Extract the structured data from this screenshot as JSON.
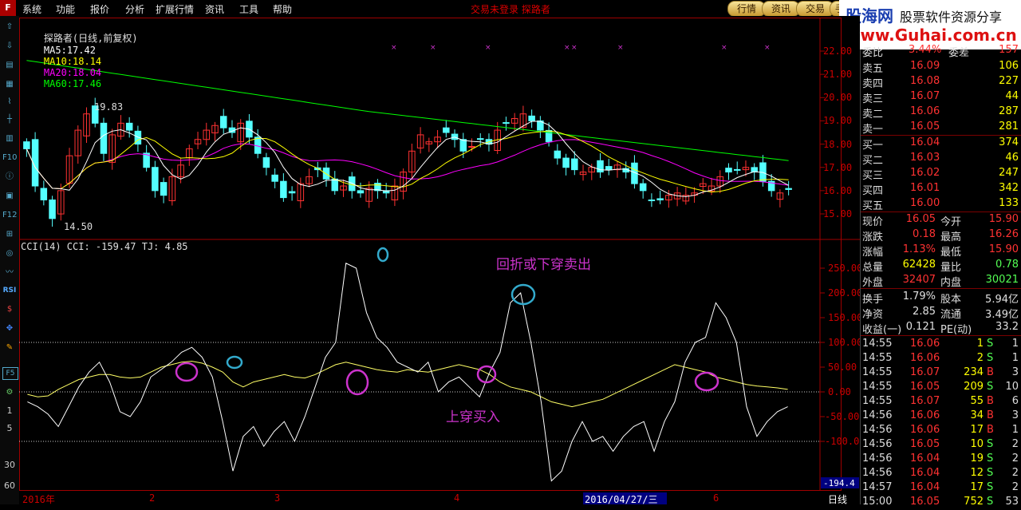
{
  "menu": {
    "logo": "F",
    "items": [
      "系统",
      "功能",
      "报价",
      "分析",
      "扩展行情",
      "资讯",
      "工具",
      "帮助"
    ],
    "title": "交易未登录   探路者",
    "tabs": [
      "行情",
      "资讯",
      "交易",
      "手"
    ]
  },
  "ad": {
    "site": "股海网",
    "slogan": "股票软件资源分享",
    "url": "www.Guhai.com.cn"
  },
  "toolbar": {
    "icons": [
      "up-arrow-icon",
      "down-arrow-icon",
      "left-arrow-icon",
      "right-arrow-icon",
      "report-icon",
      "grid-icon",
      "line-chart-icon",
      "kline-icon",
      "candles-icon",
      "f10-icon",
      "info-icon",
      "table-icon",
      "f12-icon",
      "quote-icon",
      "circle-icon",
      "rsi-icon",
      "dollar-icon",
      "cross-icon",
      "pencil-icon",
      "f5-icon",
      "settings-icon"
    ],
    "rsi_label": "RSI",
    "f5_label": "F5",
    "f10_label": "F10",
    "f12_label": "F12",
    "periods": [
      "1",
      "5",
      "30",
      "60"
    ]
  },
  "price_legend": {
    "name": "探路者(日线,前复权)",
    "ma5_label": "MA5:",
    "ma5": "17.42",
    "ma10_label": "MA10:",
    "ma10": "18.14",
    "ma20_label": "MA20:",
    "ma20": "18.04",
    "ma60_label": "MA60:",
    "ma60": "17.46",
    "high_mark": "19.83",
    "low_mark": "14.50"
  },
  "cci_legend": {
    "text": "CCI(14) CCI: -159.47 TJ: 4.85"
  },
  "annotations": {
    "sell": "回折或下穿卖出",
    "buy": "上穿买入"
  },
  "price_axis": [
    "22.00",
    "21.00",
    "20.00",
    "19.00",
    "18.00",
    "17.00",
    "16.00",
    "15.00"
  ],
  "cci_axis": [
    "250.00",
    "200.00",
    "150.00",
    "100.00",
    "50.00",
    "0.00",
    "-50.00",
    "-100.00"
  ],
  "cci_cursor_value": "-194.4",
  "date_axis": {
    "labels": [
      "2016年",
      "2",
      "3",
      "4",
      "6"
    ],
    "highlight": "2016/04/27/三",
    "period": "日线"
  },
  "colors": {
    "up": "#ff3232",
    "down": "#54ffff",
    "ma5": "#ffffff",
    "ma10": "#ffff00",
    "ma20": "#ff00ff",
    "ma60": "#00ff00",
    "annotation": "#cc33cc",
    "circle_teal": "#33aacc"
  },
  "order_book": {
    "header": [
      "委比",
      "3.44%",
      "委差",
      "157"
    ],
    "asks": [
      {
        "label": "卖五",
        "price": "16.09",
        "vol": "106"
      },
      {
        "label": "卖四",
        "price": "16.08",
        "vol": "227"
      },
      {
        "label": "卖三",
        "price": "16.07",
        "vol": "44"
      },
      {
        "label": "卖二",
        "price": "16.06",
        "vol": "287"
      },
      {
        "label": "卖一",
        "price": "16.05",
        "vol": "281"
      }
    ],
    "bids": [
      {
        "label": "买一",
        "price": "16.04",
        "vol": "374"
      },
      {
        "label": "买二",
        "price": "16.03",
        "vol": "46"
      },
      {
        "label": "买三",
        "price": "16.02",
        "vol": "247"
      },
      {
        "label": "买四",
        "price": "16.01",
        "vol": "342"
      },
      {
        "label": "买五",
        "price": "16.00",
        "vol": "133"
      }
    ]
  },
  "stats": [
    {
      "k1": "现价",
      "v1": "16.05",
      "k2": "今开",
      "v2": "15.90",
      "c1": "#ff3232",
      "c2": "#ff3232"
    },
    {
      "k1": "涨跌",
      "v1": "0.18",
      "k2": "最高",
      "v2": "16.26",
      "c1": "#ff3232",
      "c2": "#ff3232"
    },
    {
      "k1": "涨幅",
      "v1": "1.13%",
      "k2": "最低",
      "v2": "15.90",
      "c1": "#ff3232",
      "c2": "#ff3232"
    },
    {
      "k1": "总量",
      "v1": "62428",
      "k2": "量比",
      "v2": "0.78",
      "c1": "#ffff00",
      "c2": "#54ff54"
    },
    {
      "k1": "外盘",
      "v1": "32407",
      "k2": "内盘",
      "v2": "30021",
      "c1": "#ff3232",
      "c2": "#54ff54"
    },
    {
      "k1": "换手",
      "v1": "1.79%",
      "k2": "股本",
      "v2": "5.94亿",
      "c1": "#e0e0e0",
      "c2": "#e0e0e0"
    },
    {
      "k1": "净资",
      "v1": "2.85",
      "k2": "流通",
      "v2": "3.49亿",
      "c1": "#e0e0e0",
      "c2": "#e0e0e0"
    },
    {
      "k1": "收益(一)",
      "v1": "0.121",
      "k2": "PE(动)",
      "v2": "33.2",
      "c1": "#e0e0e0",
      "c2": "#e0e0e0"
    }
  ],
  "ticks": [
    {
      "time": "14:55",
      "price": "16.06",
      "vol": "1",
      "side": "S",
      "n": "1"
    },
    {
      "time": "14:55",
      "price": "16.06",
      "vol": "2",
      "side": "S",
      "n": "1"
    },
    {
      "time": "14:55",
      "price": "16.07",
      "vol": "234",
      "side": "B",
      "n": "3"
    },
    {
      "time": "14:55",
      "price": "16.05",
      "vol": "209",
      "side": "S",
      "n": "10"
    },
    {
      "time": "14:55",
      "price": "16.07",
      "vol": "55",
      "side": "B",
      "n": "6"
    },
    {
      "time": "14:56",
      "price": "16.06",
      "vol": "34",
      "side": "B",
      "n": "3"
    },
    {
      "time": "14:56",
      "price": "16.06",
      "vol": "17",
      "side": "B",
      "n": "1"
    },
    {
      "time": "14:56",
      "price": "16.05",
      "vol": "10",
      "side": "S",
      "n": "2"
    },
    {
      "time": "14:56",
      "price": "16.04",
      "vol": "19",
      "side": "S",
      "n": "2"
    },
    {
      "time": "14:56",
      "price": "16.04",
      "vol": "12",
      "side": "S",
      "n": "2"
    },
    {
      "time": "14:57",
      "price": "16.04",
      "vol": "17",
      "side": "S",
      "n": "2"
    },
    {
      "time": "15:00",
      "price": "16.05",
      "vol": "752",
      "side": "S",
      "n": "53"
    }
  ],
  "chart_data": {
    "type": "line",
    "candles_close": [
      17.8,
      16.2,
      15.6,
      14.8,
      16.0,
      17.5,
      18.6,
      19.3,
      18.9,
      17.6,
      18.4,
      18.9,
      18.6,
      18.0,
      17.0,
      16.0,
      15.8,
      16.6,
      17.1,
      17.8,
      18.2,
      18.6,
      18.8,
      18.7,
      18.5,
      18.9,
      18.3,
      17.6,
      17.0,
      16.4,
      15.7,
      15.9,
      16.3,
      16.6,
      16.9,
      16.5,
      16.0,
      16.2,
      16.0,
      15.9,
      16.1,
      16.0,
      15.9,
      16.2,
      16.8,
      17.7,
      18.4,
      18.1,
      18.3,
      18.5,
      18.2,
      17.7,
      17.9,
      18.2,
      18.0,
      18.6,
      18.9,
      19.1,
      19.3,
      19.0,
      18.6,
      18.1,
      17.4,
      17.0,
      16.9,
      16.8,
      17.0,
      16.8,
      16.9,
      17.1,
      16.8,
      16.3,
      16.0,
      15.6,
      15.6,
      15.8,
      15.9,
      15.8,
      15.9,
      16.3,
      16.2,
      16.6,
      16.8,
      16.9,
      17.0,
      16.8,
      16.4,
      16.0,
      15.9,
      16.05
    ],
    "cci": [
      -20,
      -30,
      -45,
      -70,
      -30,
      10,
      40,
      60,
      20,
      -40,
      -50,
      -20,
      30,
      45,
      60,
      80,
      90,
      70,
      30,
      -60,
      -160,
      -90,
      -70,
      -110,
      -80,
      -60,
      -100,
      -50,
      10,
      70,
      100,
      260,
      250,
      160,
      110,
      90,
      60,
      50,
      40,
      60,
      0,
      20,
      30,
      10,
      -10,
      40,
      80,
      180,
      200,
      100,
      -20,
      -180,
      -160,
      -100,
      -60,
      -100,
      -90,
      -120,
      -90,
      -70,
      -60,
      -120,
      -60,
      -20,
      60,
      100,
      110,
      180,
      150,
      100,
      -30,
      -90,
      -60,
      -40,
      -30
    ],
    "tj": [
      -5,
      -10,
      -8,
      5,
      15,
      25,
      30,
      35,
      35,
      30,
      28,
      30,
      40,
      50,
      55,
      60,
      62,
      58,
      50,
      40,
      20,
      10,
      20,
      25,
      30,
      35,
      30,
      28,
      35,
      45,
      55,
      60,
      55,
      50,
      45,
      42,
      40,
      45,
      42,
      40,
      45,
      50,
      55,
      50,
      45,
      35,
      20,
      10,
      5,
      0,
      -10,
      -20,
      -25,
      -30,
      -25,
      -20,
      -15,
      -5,
      5,
      15,
      25,
      35,
      45,
      55,
      50,
      45,
      40,
      30,
      25,
      20,
      15,
      12,
      10,
      8,
      5
    ],
    "series": [
      {
        "name": "MA5",
        "values": []
      },
      {
        "name": "MA10",
        "values": []
      },
      {
        "name": "MA20",
        "values": []
      },
      {
        "name": "MA60",
        "values": []
      },
      {
        "name": "CCI",
        "values": []
      },
      {
        "name": "TJ",
        "values": []
      }
    ],
    "ylim_price": [
      14.5,
      22.5
    ],
    "ylim_cci": [
      -200,
      300
    ]
  }
}
